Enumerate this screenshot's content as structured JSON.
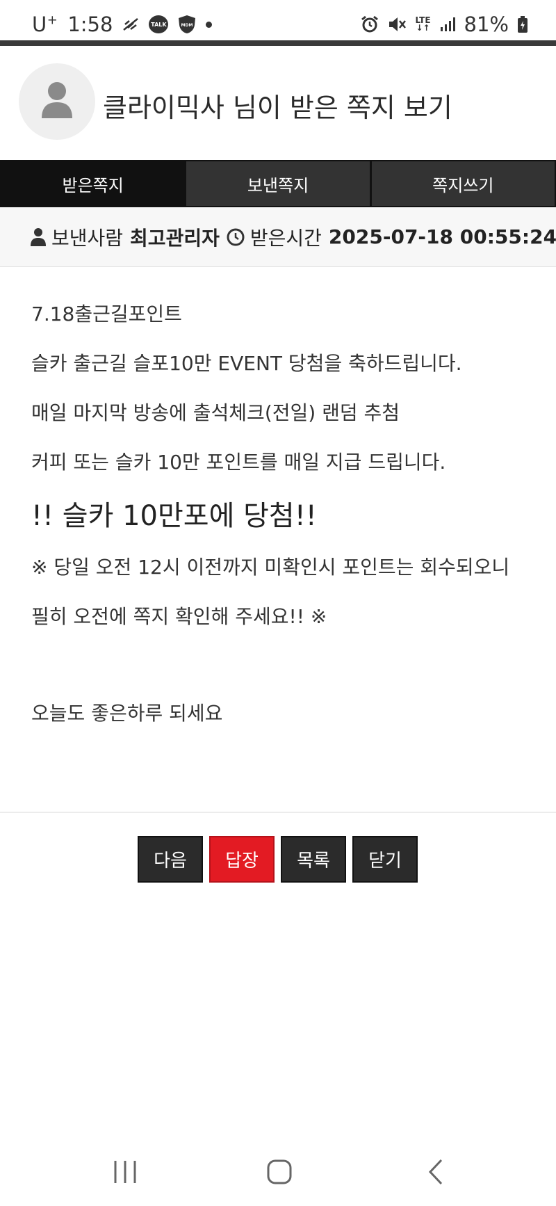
{
  "status_bar": {
    "carrier": "U",
    "carrier_sup": "+",
    "time": "1:58",
    "talk_badge": "TALK",
    "lte_top": "LTE",
    "lte_bottom": "↓↑",
    "battery": "81%",
    "icons": [
      "signal-slash-icon",
      "talk-icon",
      "shield-icon",
      "dot-icon",
      "alarm-icon",
      "mute-icon",
      "lte-icon",
      "signal-icon",
      "battery-icon"
    ]
  },
  "header": {
    "title": "클라이믹사 님이 받은 쪽지 보기",
    "avatar_icon": "user-icon"
  },
  "tabs": [
    {
      "label": "받은쪽지",
      "active": true
    },
    {
      "label": "보낸쪽지",
      "active": false
    },
    {
      "label": "쪽지쓰기",
      "active": false
    }
  ],
  "meta": {
    "sender_label": "보낸사람",
    "sender": "최고관리자",
    "time_label": "받은시간",
    "received_at": "2025-07-18 00:55:24"
  },
  "message": {
    "lines": [
      "7.18출근길포인트",
      "슬카 출근길 슬포10만 EVENT 당첨을 축하드립니다.",
      "매일 마지막 방송에 출석체크(전일) 랜덤 추첨",
      "커피 또는 슬카 10만 포인트를 매일 지급 드립니다.",
      "!! 슬카 10만포에 당첨!!",
      "※ 당일 오전 12시 이전까지 미확인시 포인트는 회수되오니",
      "필히 오전에 쪽지 확인해 주세요!! ※",
      "오늘도 좋은하루 되세요"
    ]
  },
  "buttons": {
    "next": "다음",
    "reply": "답장",
    "list": "목록",
    "close": "닫기"
  },
  "colors": {
    "accent_red": "#e31b23",
    "tab_active": "#111111",
    "tab_inactive": "#333333",
    "button_dark": "#2b2b2b"
  }
}
